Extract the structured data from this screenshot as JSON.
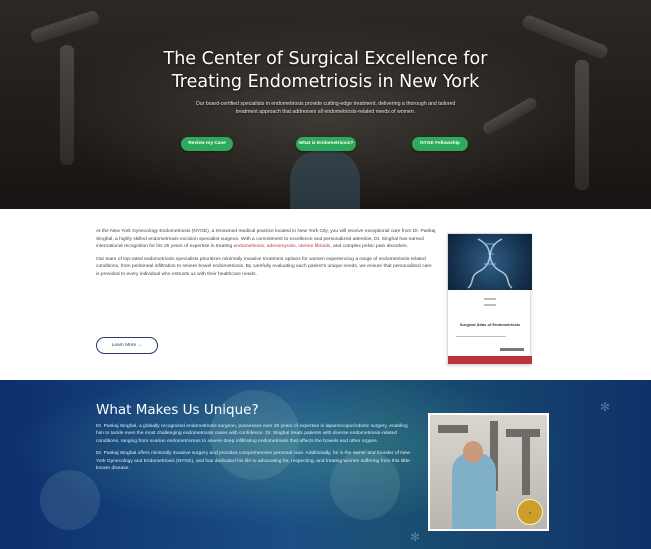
{
  "hero": {
    "title_line1": "The Center of Surgical Excellence for",
    "title_line2": "Treating Endometriosis in New York",
    "subtitle": "Our board-certified specialists in endometriosis provide cutting-edge treatment, delivering a thorough and tailored treatment approach that addresses all endometriosis-related needs of women.",
    "buttons": [
      "Review my Case",
      "What is Endometriosis?",
      "NYGE Fellowship"
    ],
    "accent": "#2eaa5c"
  },
  "intro": {
    "p1_a": "At the New York Gynecology Endometriosis (NYGE), a renowned medical practice located in New York City, you will receive exceptional care from Dr. Pankaj Singhal, a highly skilled endometriosis excision specialist surgeon. With a commitment to excellence and personalized attention, Dr. Singhal has earned international recognition for his 25 years of expertise in treating ",
    "p1_links": "endometriosis, adenomyosis, uterine fibroids,",
    "p1_b": " and complex pelvic pain disorders.",
    "p2": "Our team of top-rated endometriosis specialists prioritizes minimally invasive treatment options for women experiencing a range of endometriosis-related conditions, from peritoneal infiltration to severe bowel endometriosis. By carefully evaluating each patient's unique needs, we ensure that personalized care is provided to every individual who entrusts us with their healthcare needs.",
    "learn_more": "Learn More →",
    "link_color": "#b53a3a"
  },
  "book": {
    "title": "Surgical Atlas of Endometriosis"
  },
  "unique": {
    "title": "What Makes Us Unique?",
    "p1": "Dr. Pankaj Singhal, a globally recognized endometriosis surgeon, possesses over 25 years of expertise in laparoscopic/robotic surgery, enabling him to tackle even the most challenging endometriosis cases with confidence. Dr. Singhal treats patients with diverse endometriosis-related conditions, ranging from ovarian endometriomas to severe deep infiltrating endometriosis that affects the bowels and other organs.",
    "p2": "Dr. Pankaj Singhal offers minimally invasive surgery and provides comprehensive personal care. Additionally, he is the owner and founder of New York Gynecology and Endometriosis (NYGE), and has dedicated his life to advocating for, respecting, and treating women suffering from this little-known disease."
  }
}
